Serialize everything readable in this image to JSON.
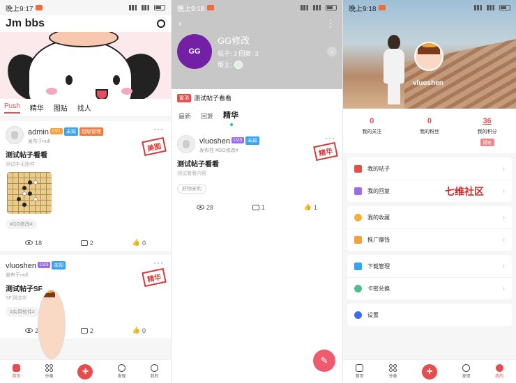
{
  "status": {
    "left": {
      "time": "晚上9:17"
    },
    "mid": {
      "time": "晚上9:18"
    },
    "right": {
      "time": "晚上9:18"
    }
  },
  "colors": {
    "accent": "#e84d4d",
    "purple_logo": "#7420a6",
    "fab": "#f05a6e"
  },
  "home": {
    "app_title": "Jm bbs",
    "tabs": [
      "Push",
      "精华",
      "图贴",
      "找人"
    ],
    "posts": [
      {
        "user": "admin",
        "badges": [
          "LV1",
          "未知",
          "超级管理"
        ],
        "meta": "发布于null",
        "stamp": "美图",
        "title": "测试帖子看看",
        "sub": "测试中无附件",
        "tag": "#GG修改#",
        "views": "18",
        "comments": "2",
        "likes": "0"
      },
      {
        "user": "vluoshen",
        "badges": [
          "LV3",
          "未知"
        ],
        "meta": "发布于null",
        "stamp": "精华",
        "title": "测试帖子SF",
        "sub": "SF测试中",
        "tag": "#实用软件#",
        "views": "24",
        "comments": "2",
        "likes": "0"
      }
    ]
  },
  "nav": {
    "home": "首页",
    "category": "分类",
    "discover": "发现",
    "me": "我的",
    "plus": "+"
  },
  "forum": {
    "name": "GG修改",
    "logo_text": "GG",
    "stats": "帖子: 3  回复: 3",
    "moderator_label": "版主:",
    "pin_badge": "置顶",
    "pin_title": "测试帖子看看",
    "tabs": [
      "最新",
      "回复",
      "精华"
    ],
    "post": {
      "user": "vluoshen",
      "badges": [
        "LV3",
        "未知"
      ],
      "meta": "发布在 #GG修改#",
      "stamp": "精华",
      "title": "测试帖子看看",
      "sub": "测试看看内容",
      "tag": "好物安利",
      "views": "28",
      "comments": "1",
      "likes": "1"
    }
  },
  "profile": {
    "username": "vluoshen",
    "follow_count": "0",
    "follow_label": "我的关注",
    "fans_count": "0",
    "fans_label": "我的粉丝",
    "points_count": "36",
    "points_label": "我的积分",
    "points_btn": "提现",
    "watermark": "七维社区",
    "groups": [
      [
        {
          "label": "我的帖子",
          "icon": "post-icon",
          "color": "#e84d4d"
        },
        {
          "label": "我的回复",
          "icon": "reply-icon",
          "color": "#9b6bf0"
        }
      ],
      [
        {
          "label": "我的收藏",
          "icon": "star-icon",
          "color": "#f2b13b"
        },
        {
          "label": "推广赚钱",
          "icon": "gift-icon",
          "color": "#f2a13b"
        }
      ],
      [
        {
          "label": "下载管理",
          "icon": "download-icon",
          "color": "#3ba4f2"
        },
        {
          "label": "卡密兑换",
          "icon": "redeem-icon",
          "color": "#4cc08a"
        }
      ],
      [
        {
          "label": "设置",
          "icon": "settings-icon",
          "color": "#3b6cf2"
        }
      ]
    ]
  }
}
